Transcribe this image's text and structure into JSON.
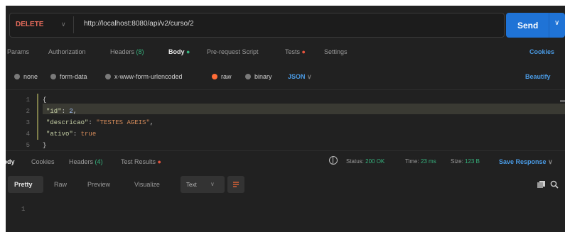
{
  "request": {
    "method": "DELETE",
    "url": "http://localhost:8080/api/v2/curso/2",
    "send_label": "Send"
  },
  "request_tabs": [
    {
      "label": "Params"
    },
    {
      "label": "Authorization"
    },
    {
      "label": "Headers",
      "count": "(8)"
    },
    {
      "label": "Body",
      "active": true
    },
    {
      "label": "Pre-request Script"
    },
    {
      "label": "Tests"
    },
    {
      "label": "Settings"
    }
  ],
  "cookies_link": "Cookies",
  "body_types": [
    "none",
    "form-data",
    "x-www-form-urlencoded",
    "raw",
    "binary"
  ],
  "body_type_selected": "raw",
  "body_language": "JSON",
  "beautify_label": "Beautify",
  "editor": {
    "line_numbers": [
      "1",
      "2",
      "3",
      "4",
      "5"
    ],
    "lines": [
      [
        "{"
      ],
      [
        "\"id\"",
        ": ",
        "2",
        ","
      ],
      [
        "\"descricao\"",
        ": ",
        "\"TESTES AGEIS\"",
        ","
      ],
      [
        "\"ativo\"",
        ": ",
        "true"
      ],
      [
        "}"
      ]
    ]
  },
  "response_tabs": [
    {
      "label": "Body",
      "active": true
    },
    {
      "label": "Cookies"
    },
    {
      "label": "Headers",
      "count": "(4)"
    },
    {
      "label": "Test Results"
    }
  ],
  "status": {
    "status_label": "Status:",
    "status_value": "200 OK",
    "time_label": "Time:",
    "time_value": "23 ms",
    "size_label": "Size:",
    "size_value": "123 B"
  },
  "save_response_label": "Save Response",
  "view_tabs": [
    "Pretty",
    "Raw",
    "Preview",
    "Visualize"
  ],
  "view_format": "Text",
  "response_line_numbers": [
    "1"
  ],
  "colors": {
    "accent": "#1f73d6",
    "method": "#e66b5b",
    "success": "#36b37e",
    "link": "#4a9be5",
    "background": "#212121"
  },
  "icons": [
    "chevron-down-icon",
    "globe-icon",
    "wrap-lines-icon",
    "copy-icon",
    "search-icon"
  ]
}
